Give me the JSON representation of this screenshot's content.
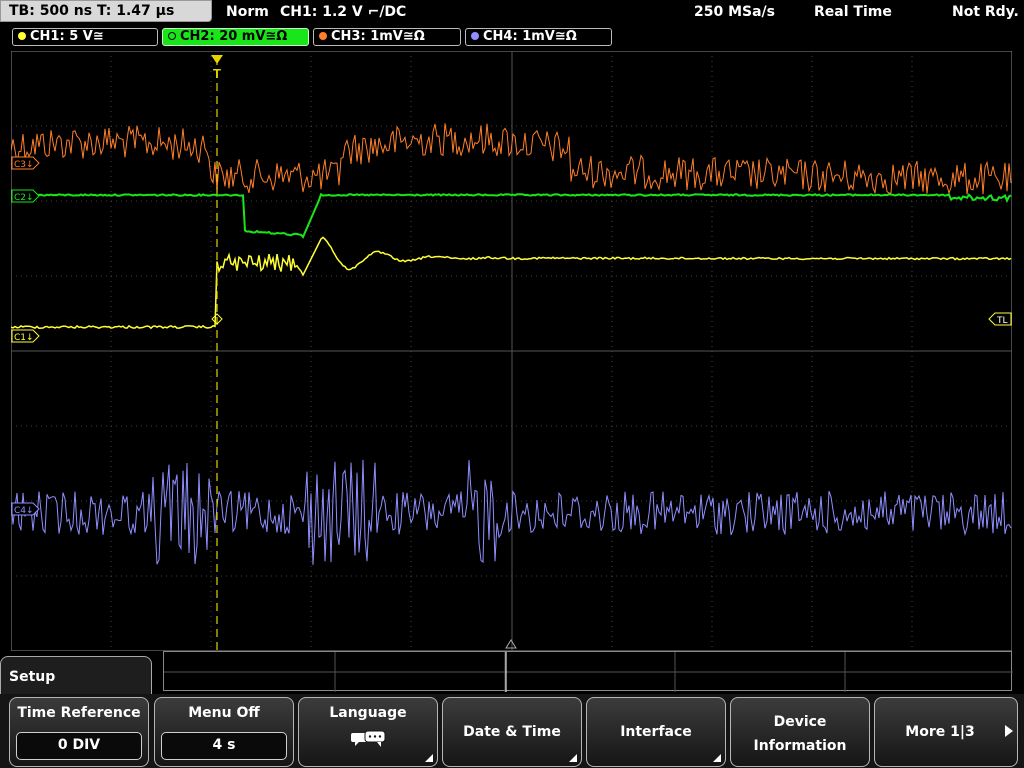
{
  "status_bar": {
    "timebase": "TB: 500 ns   T: 1.47 µs",
    "trigger_mode": "Norm",
    "trigger_info": "CH1: 1.2 V ⌐/DC",
    "sample_rate": "250 MSa/s",
    "acq_mode": "Real Time",
    "status": "Not Rdy."
  },
  "channels": [
    {
      "label": "CH1: 5 V≅",
      "color": "#ffff33",
      "active": false
    },
    {
      "label": "CH2: 20 mV≅Ω",
      "color": "#19e619",
      "active": true
    },
    {
      "label": "CH3: 1mV≅Ω",
      "color": "#ff7f2a",
      "active": false
    },
    {
      "label": "CH4: 1mV≅Ω",
      "color": "#8f8fff",
      "active": false
    }
  ],
  "markers": {
    "ch1": "C1↓",
    "ch2": "C2↓",
    "ch3": "C3↓",
    "ch4": "C4↓",
    "trigger_level": "TL",
    "trigger_pos": "T"
  },
  "colors": {
    "ch1": "#ffff33",
    "ch2": "#19e619",
    "ch3": "#ff7f2a",
    "ch4": "#8f8fff",
    "grid": "#555555",
    "trigger_line": "#e6d200"
  },
  "menu": {
    "title": "Setup",
    "softkeys": {
      "time_reference": {
        "label": "Time Reference",
        "value": "0 DIV"
      },
      "menu_off": {
        "label": "Menu Off",
        "value": "4 s"
      },
      "language": {
        "label": "Language",
        "icon": "speech-bubbles-icon"
      },
      "date_time": {
        "label": "Date & Time"
      },
      "interface": {
        "label": "Interface"
      },
      "device_information": {
        "label_line1": "Device",
        "label_line2": "Information"
      },
      "more": {
        "label": "More 1|3"
      }
    }
  }
}
